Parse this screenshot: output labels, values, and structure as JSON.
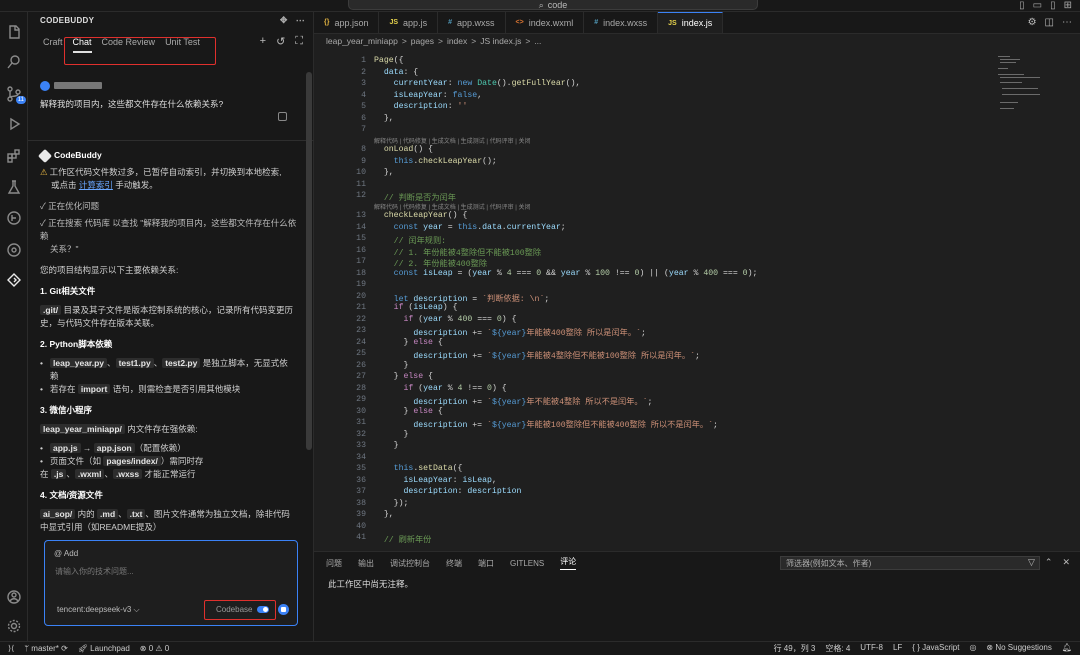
{
  "window": {
    "search_text": "code"
  },
  "panel": {
    "title": "CODEBUDDY",
    "tabs": [
      "Craft",
      "Chat",
      "Code Review",
      "Unit Test"
    ],
    "active_tab": "Chat",
    "user_question": "解释我的项目内，这些都文件存在什么依赖关系?",
    "bot_name": "CodeBuddy",
    "warning_a": "工作区代码文件数过多，已暂停自动索引，并切换到本地检索,",
    "warning_b1": "或点击 ",
    "warning_link": "计算索引",
    "warning_b2": " 手动触发。",
    "step1": "✓ 正在优化问题",
    "step2a": "✓ 正在搜索 代码库 以查找 \"解释我的项目内，这些都文件存在什么依赖",
    "step2b": "关系？\"",
    "intro": "您的项目结构显示以下主要依赖关系:",
    "s1": "1. Git相关文件",
    "s1_code": ".git/",
    "s1_text": " 目录及其子文件是版本控制系统的核心，记录所有代码变更历史，与代码文件存在版本关联。",
    "s2": "2. Python脚本依赖",
    "s2_f1": "leap_year.py",
    "s2_f2": "test1.py",
    "s2_f3": "test2.py",
    "s2_t1": " 是独立脚本，无显式依",
    "s2_t2": "赖",
    "s2_b2a": "若存在 ",
    "s2_b2code": "import",
    "s2_b2b": " 语句，则需检查是否引用其他模块",
    "s3": "3. 微信小程序",
    "s3_code": "leap_year_miniapp/",
    "s3_text": " 内文件存在强依赖:",
    "s3_b1a": "app.js",
    "s3_b1b": "app.json",
    "s3_b1c": "（配置依赖）",
    "s3_b2a": "页面文件（如 ",
    "s3_b2code": "pages/index/",
    "s3_b2b": "）需同时存",
    "s3_b3a": "在 ",
    "s3_b3c1": ".js",
    "s3_b3c2": ".wxml",
    "s3_b3c3": ".wxss",
    "s3_b3b": " 才能正常运行",
    "s4": "4. 文档/资源文件",
    "s4_code1": "ai_sop/",
    "s4_t1": " 内的 ",
    "s4_code2": ".md",
    "s4_code3": ".txt",
    "s4_t2": "、图片文件通常为独立文档，除非代码",
    "s4_t3": "中显式引用（如README提及）",
    "input_tag": "@ Add",
    "input_placeholder": "请输入你的技术问题...",
    "model": "tencent:deepseek-v3 ⌵",
    "codebase": "Codebase"
  },
  "editor": {
    "tabs": [
      {
        "icon": "{}",
        "kind": "json",
        "name": "app.json"
      },
      {
        "icon": "JS",
        "kind": "js",
        "name": "app.js"
      },
      {
        "icon": "#",
        "kind": "css",
        "name": "app.wxss"
      },
      {
        "icon": "<>",
        "kind": "xml",
        "name": "index.wxml"
      },
      {
        "icon": "#",
        "kind": "css",
        "name": "index.wxss"
      },
      {
        "icon": "JS",
        "kind": "js",
        "name": "index.js"
      }
    ],
    "breadcrumb": [
      "leap_year_miniapp",
      ">",
      "pages",
      ">",
      "index",
      ">",
      "JS index.js",
      ">",
      "..."
    ],
    "codelens": "解释代码 | 代码修复 | 生成文档 | 生成测试 | 代码评审 | 关闭"
  },
  "bottom_panel": {
    "tabs": [
      "问题",
      "输出",
      "调试控制台",
      "终端",
      "端口",
      "GITLENS",
      "评论"
    ],
    "active": "评论",
    "filter_placeholder": "筛选器(例如文本、作者)",
    "message": "此工作区中尚无注释。"
  },
  "status": {
    "branch": "master*",
    "launchpad": "Launchpad",
    "problems": "⊗ 0 ⚠ 0",
    "cursor": "行 49，列 3",
    "spaces": "空格: 4",
    "encoding": "UTF-8",
    "eol": "LF",
    "lang": "{ } JavaScript",
    "suggest": "No Suggestions"
  },
  "activity": {
    "scm_badge": "11"
  }
}
